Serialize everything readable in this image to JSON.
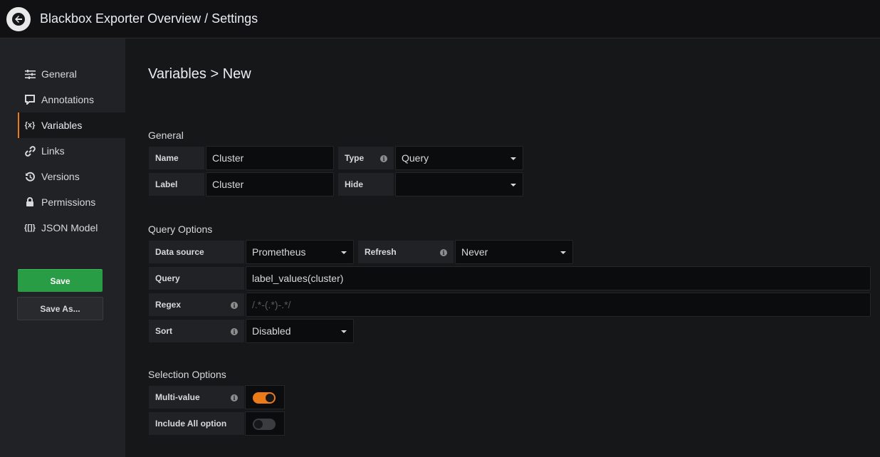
{
  "header": {
    "title": "Blackbox Exporter Overview / Settings"
  },
  "sidebar": {
    "items": [
      {
        "label": "General",
        "icon": "sliders-icon"
      },
      {
        "label": "Annotations",
        "icon": "comment-icon"
      },
      {
        "label": "Variables",
        "icon": "variable-icon",
        "icon_text": "{x}",
        "active": true
      },
      {
        "label": "Links",
        "icon": "link-icon"
      },
      {
        "label": "Versions",
        "icon": "history-icon"
      },
      {
        "label": "Permissions",
        "icon": "lock-icon"
      },
      {
        "label": "JSON Model",
        "icon": "json-icon",
        "icon_text": "{[]}"
      }
    ],
    "save_label": "Save",
    "save_as_label": "Save As..."
  },
  "main": {
    "heading": "Variables > New",
    "general": {
      "title": "General",
      "name_label": "Name",
      "name_value": "Cluster",
      "type_label": "Type",
      "type_value": "Query",
      "label_label": "Label",
      "label_value": "Cluster",
      "hide_label": "Hide",
      "hide_value": ""
    },
    "query_options": {
      "title": "Query Options",
      "datasource_label": "Data source",
      "datasource_value": "Prometheus",
      "refresh_label": "Refresh",
      "refresh_value": "Never",
      "query_label": "Query",
      "query_value": "label_values(cluster)",
      "regex_label": "Regex",
      "regex_placeholder": "/.*-(.*)-.*/",
      "sort_label": "Sort",
      "sort_value": "Disabled"
    },
    "selection_options": {
      "title": "Selection Options",
      "multi_label": "Multi-value",
      "multi_on": true,
      "include_all_label": "Include All option",
      "include_all_on": false
    }
  },
  "colors": {
    "accent": "#eb7b18",
    "save": "#299c46",
    "background": "#161719"
  }
}
